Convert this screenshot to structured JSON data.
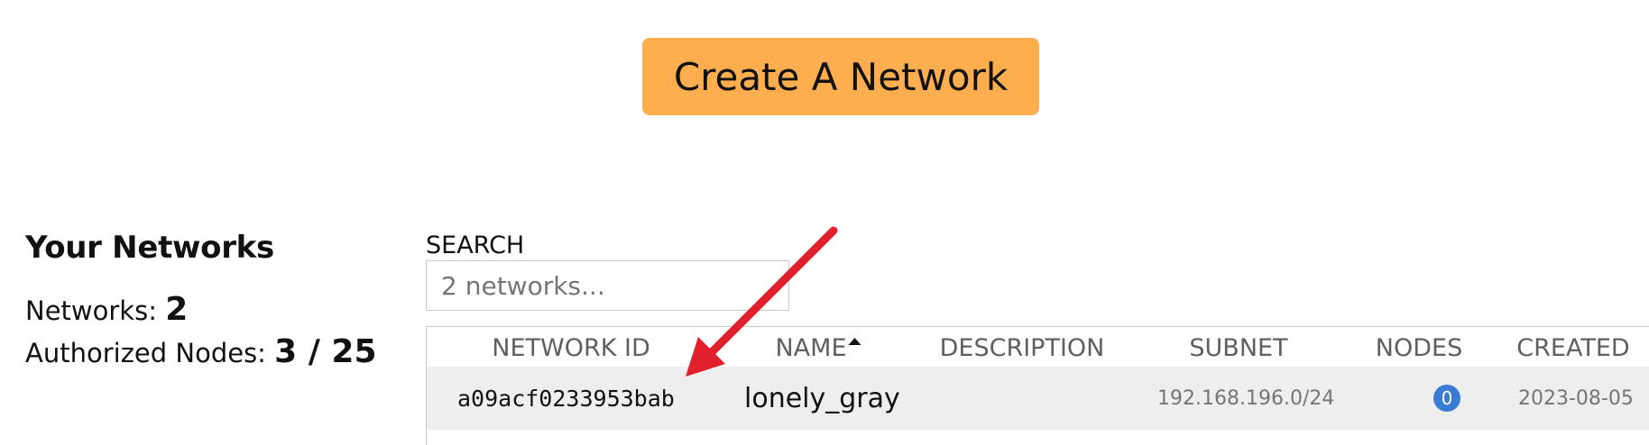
{
  "header": {
    "create_button_label": "Create A Network"
  },
  "summary": {
    "title": "Your Networks",
    "networks_label": "Networks:",
    "networks_count": "2",
    "authorized_label": "Authorized Nodes:",
    "authorized_value": "3 / 25"
  },
  "search": {
    "label": "SEARCH",
    "placeholder": "2 networks...",
    "value": ""
  },
  "table": {
    "columns": [
      "NETWORK ID",
      "NAME",
      "DESCRIPTION",
      "SUBNET",
      "NODES",
      "CREATED"
    ],
    "sort_column": "NAME",
    "sort_direction": "ascending",
    "rows": [
      {
        "network_id": "a09acf0233953bab",
        "name": "lonely_gray",
        "description": "",
        "subnet": "192.168.196.0/24",
        "nodes": "0",
        "created": "2023-08-05"
      }
    ]
  },
  "colors": {
    "create_button": "#ffae4f",
    "row_background": "#eeeeee",
    "nodes_badge": "#3a7bd5",
    "annotation_arrow": "#e0202a"
  },
  "icons": {
    "sort": "caret-up-icon",
    "annotation": "red-arrow-icon"
  }
}
